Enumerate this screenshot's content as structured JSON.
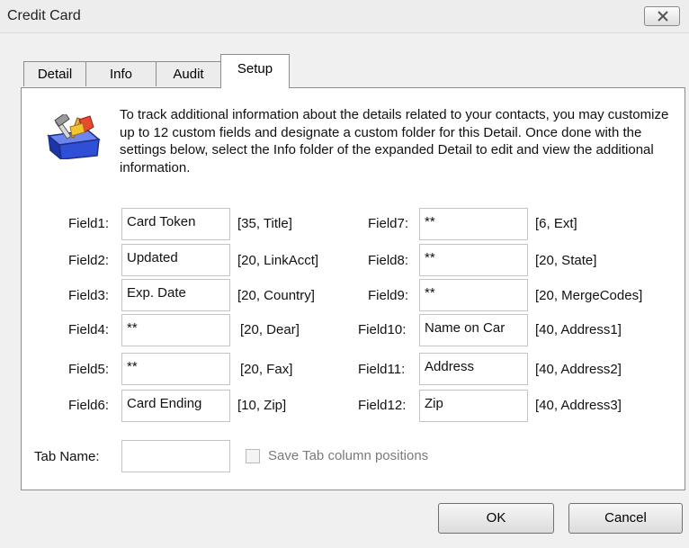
{
  "window": {
    "title": "Credit Card"
  },
  "tabs": [
    {
      "label": "Detail",
      "active": false
    },
    {
      "label": "Info",
      "active": false
    },
    {
      "label": "Audit",
      "active": false
    },
    {
      "label": "Setup",
      "active": true
    }
  ],
  "intro": {
    "text": "To track additional information about the details related to your contacts, you may customize up to 12 custom fields and designate a custom folder for this Detail.  Once done with the settings below, select the Info folder of the expanded Detail to edit and view the additional information.",
    "icon": "toolbox-icon"
  },
  "fields": [
    {
      "label": "Field1:",
      "value": "Card Token",
      "spec": "[35, Title]"
    },
    {
      "label": "Field2:",
      "value": "Updated",
      "spec": "[20, LinkAcct]"
    },
    {
      "label": "Field3:",
      "value": "Exp. Date",
      "spec": "[20, Country]"
    },
    {
      "label": "Field4:",
      "value": "**",
      "spec": "[20, Dear]"
    },
    {
      "label": "Field5:",
      "value": "**",
      "spec": "[20, Fax]"
    },
    {
      "label": "Field6:",
      "value": "Card Ending",
      "spec": "[10, Zip]"
    },
    {
      "label": "Field7:",
      "value": "**",
      "spec": "[6, Ext]"
    },
    {
      "label": "Field8:",
      "value": "**",
      "spec": "[20, State]"
    },
    {
      "label": "Field9:",
      "value": "**",
      "spec": "[20, MergeCodes]"
    },
    {
      "label": "Field10:",
      "value": "Name on Car",
      "spec": "[40, Address1]"
    },
    {
      "label": "Field11:",
      "value": "Address",
      "spec": "[40, Address2]"
    },
    {
      "label": "Field12:",
      "value": "Zip",
      "spec": "[40, Address3]"
    }
  ],
  "tab_name": {
    "label": "Tab Name:",
    "value": ""
  },
  "save_positions": {
    "label": "Save Tab column positions",
    "checked": false,
    "enabled": false
  },
  "buttons": {
    "ok": "OK",
    "cancel": "Cancel"
  }
}
